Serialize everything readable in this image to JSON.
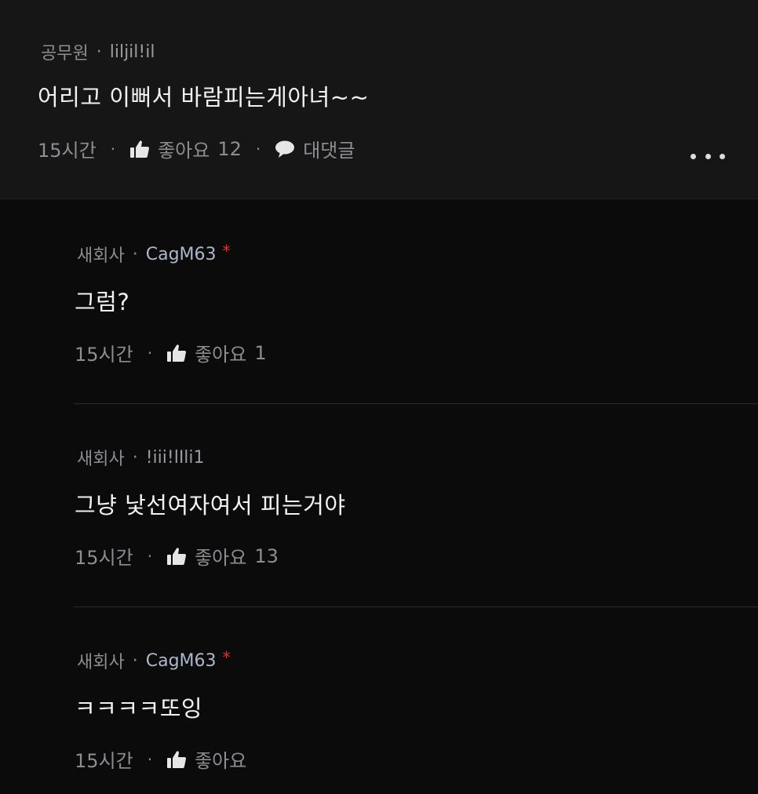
{
  "main_comment": {
    "company": "공무원",
    "nickname": "liljil!il",
    "text": "어리고 이뻐서 바람피는게아녀~~",
    "time": "15시간",
    "like_label": "좋아요",
    "like_count": "12",
    "reply_label": "대댓글",
    "more_icon": "more-dots-icon"
  },
  "replies": [
    {
      "company": "새회사",
      "nickname": "CagM63",
      "author_marker": "*",
      "text": "그럼?",
      "time": "15시간",
      "like_label": "좋아요",
      "like_count": "1"
    },
    {
      "company": "새회사",
      "nickname": "!iii!lIli1",
      "text": "그냥 낯선여자여서 피는거야",
      "time": "15시간",
      "like_label": "좋아요",
      "like_count": "13"
    },
    {
      "company": "새회사",
      "nickname": "CagM63",
      "author_marker": "*",
      "text": "ㅋㅋㅋㅋ또잉",
      "time": "15시간",
      "like_label": "좋아요",
      "like_count": ""
    }
  ],
  "colors": {
    "background": "#0b0b0c",
    "main_comment_bg": "#161617",
    "meta_text": "#8d8d92",
    "nickname_blue": "#aeb6cc",
    "author_star": "#d9362f"
  }
}
